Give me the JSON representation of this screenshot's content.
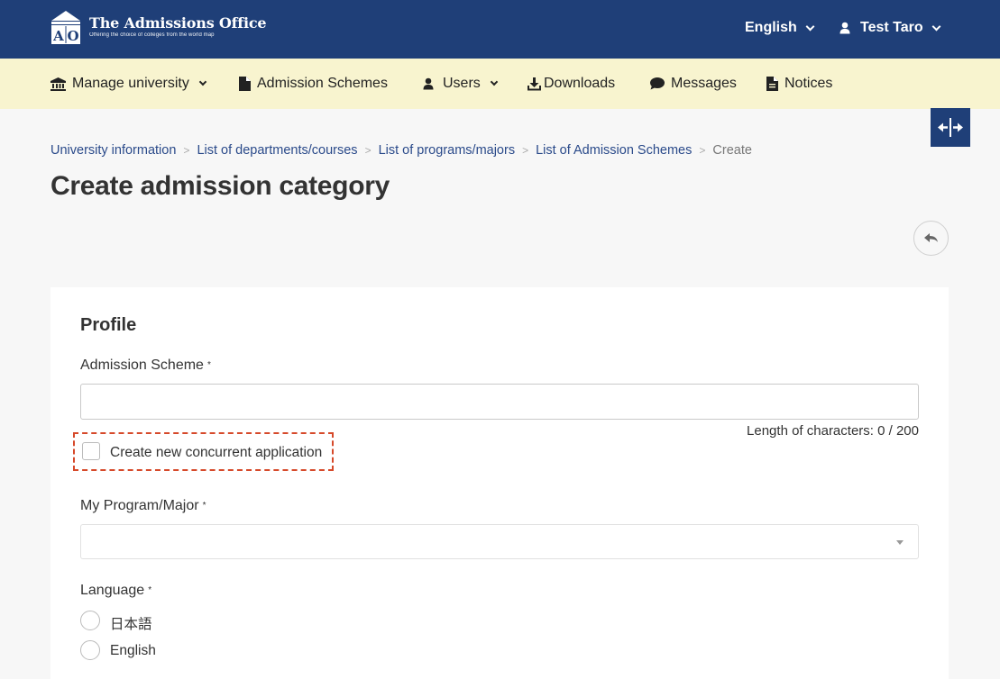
{
  "header": {
    "logo_title": "The Admissions Office",
    "logo_subtitle": "Offering the choice of colleges from the world map",
    "logo_mark": "AO",
    "language_menu": "English",
    "user_menu": "Test Taro"
  },
  "nav": {
    "items": [
      {
        "label": "Manage university",
        "icon": "university-icon"
      },
      {
        "label": "Admission Schemes",
        "icon": "document-icon"
      },
      {
        "label": "Users",
        "icon": "user-icon"
      },
      {
        "label": "Downloads",
        "icon": "download-icon"
      },
      {
        "label": "Messages",
        "icon": "chat-icon"
      },
      {
        "label": "Notices",
        "icon": "notice-icon"
      }
    ]
  },
  "breadcrumb": {
    "items": [
      "University information",
      "List of departments/courses",
      "List of programs/majors",
      "List of Admission Schemes"
    ],
    "current": "Create",
    "separator": ">"
  },
  "page": {
    "title": "Create admission category"
  },
  "form": {
    "section_title": "Profile",
    "admission_scheme": {
      "label": "Admission Scheme",
      "required_mark": "*",
      "value": "",
      "char_count_label": "Length of characters: 0 / 200"
    },
    "concurrent": {
      "label": "Create new concurrent application",
      "checked": false
    },
    "program": {
      "label": "My Program/Major",
      "required_mark": "*",
      "value": ""
    },
    "language": {
      "label": "Language",
      "required_mark": "*",
      "options": [
        "日本語",
        "English"
      ]
    }
  },
  "colors": {
    "header_bg": "#1f3f78",
    "nav_bg": "#f8f4cf",
    "highlight_dash": "#d6492a",
    "link": "#2a4a8a"
  }
}
